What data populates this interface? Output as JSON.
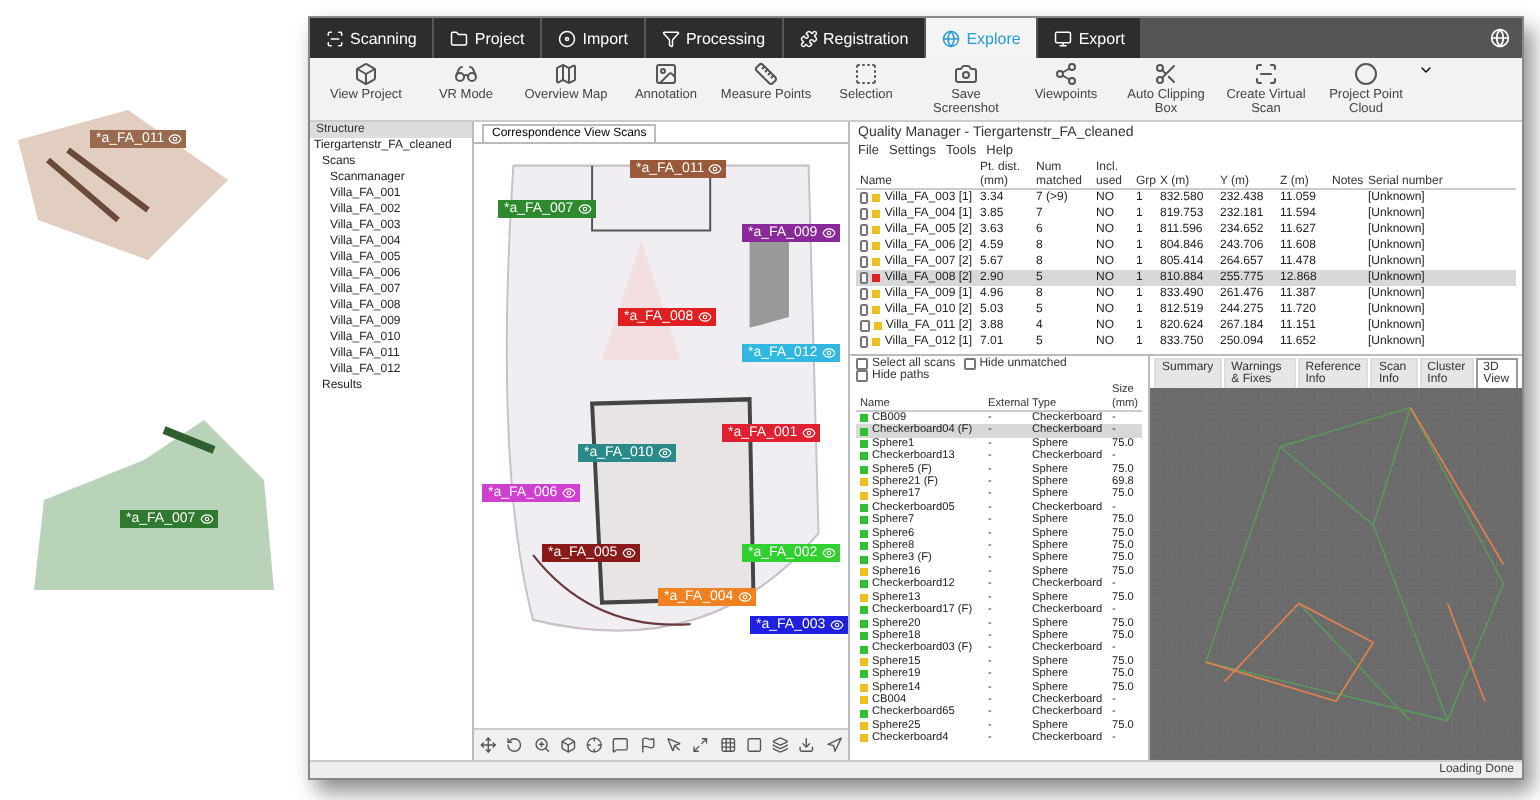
{
  "background_tags": [
    {
      "label": "*a_FA_011",
      "color": "#9a6a4e"
    },
    {
      "label": "*a_FA_007",
      "color": "#2f7a2f"
    }
  ],
  "workflow_tabs": [
    {
      "label": "Scanning",
      "selected": false
    },
    {
      "label": "Project",
      "selected": false
    },
    {
      "label": "Import",
      "selected": false
    },
    {
      "label": "Processing",
      "selected": false
    },
    {
      "label": "Registration",
      "selected": false
    },
    {
      "label": "Explore",
      "selected": true
    },
    {
      "label": "Export",
      "selected": false
    }
  ],
  "toolbar": [
    {
      "label": "View Project"
    },
    {
      "label": "VR Mode"
    },
    {
      "label": "Overview Map"
    },
    {
      "label": "Annotation"
    },
    {
      "label": "Measure Points"
    },
    {
      "label": "Selection"
    },
    {
      "label": "Save Screenshot"
    },
    {
      "label": "Viewpoints"
    },
    {
      "label": "Auto Clipping Box"
    },
    {
      "label": "Create Virtual Scan"
    },
    {
      "label": "Project Point Cloud"
    }
  ],
  "structure": {
    "title": "Structure",
    "tree": [
      {
        "label": "Tiergartenstr_FA_cleaned",
        "children": [
          {
            "label": "Scans",
            "children": [
              {
                "label": "Scanmanager"
              },
              {
                "label": "Villa_FA_001"
              },
              {
                "label": "Villa_FA_002"
              },
              {
                "label": "Villa_FA_003"
              },
              {
                "label": "Villa_FA_004"
              },
              {
                "label": "Villa_FA_005"
              },
              {
                "label": "Villa_FA_006"
              },
              {
                "label": "Villa_FA_007"
              },
              {
                "label": "Villa_FA_008"
              },
              {
                "label": "Villa_FA_009"
              },
              {
                "label": "Villa_FA_010"
              },
              {
                "label": "Villa_FA_011"
              },
              {
                "label": "Villa_FA_012"
              }
            ]
          },
          {
            "label": "Results"
          }
        ]
      }
    ]
  },
  "map": {
    "tab": "Correspondence View Scans",
    "tags": [
      {
        "label": "*a_FA_011",
        "color": "#9a5a3a"
      },
      {
        "label": "*a_FA_007",
        "color": "#2f8a2f"
      },
      {
        "label": "*a_FA_009",
        "color": "#8a2a9a"
      },
      {
        "label": "*a_FA_008",
        "color": "#e02020"
      },
      {
        "label": "*a_FA_012",
        "color": "#30b8e0"
      },
      {
        "label": "*a_FA_001",
        "color": "#e02030"
      },
      {
        "label": "*a_FA_006",
        "color": "#d040d0"
      },
      {
        "label": "*a_FA_010",
        "color": "#2a8a8a"
      },
      {
        "label": "*a_FA_005",
        "color": "#8a1a1a"
      },
      {
        "label": "*a_FA_004",
        "color": "#f08020"
      },
      {
        "label": "*a_FA_002",
        "color": "#30d030"
      },
      {
        "label": "*a_FA_003",
        "color": "#2020e0"
      }
    ]
  },
  "quality_manager": {
    "title": "Quality Manager - Tiergartenstr_FA_cleaned",
    "menu": [
      "File",
      "Settings",
      "Tools",
      "Help"
    ],
    "columns": [
      "Name",
      "Pt. dist. (mm)",
      "Num matched",
      "Incl. used",
      "Grp",
      "X (m)",
      "Y (m)",
      "Z (m)",
      "Notes",
      "Serial number"
    ],
    "rows": [
      {
        "selected": false,
        "color": "#f0c020",
        "cells": [
          "Villa_FA_003 [1]",
          "3.34",
          "7 (>9)",
          "NO",
          "1",
          "832.580",
          "232.438",
          "11.059",
          "",
          "[Unknown]"
        ]
      },
      {
        "selected": false,
        "color": "#f0c020",
        "cells": [
          "Villa_FA_004 [1]",
          "3.85",
          "7",
          "NO",
          "1",
          "819.753",
          "232.181",
          "11.594",
          "",
          "[Unknown]"
        ]
      },
      {
        "selected": false,
        "color": "#f0c020",
        "cells": [
          "Villa_FA_005 [2]",
          "3.63",
          "6",
          "NO",
          "1",
          "811.596",
          "234.652",
          "11.627",
          "",
          "[Unknown]"
        ]
      },
      {
        "selected": false,
        "color": "#f0c020",
        "cells": [
          "Villa_FA_006 [2]",
          "4.59",
          "8",
          "NO",
          "1",
          "804.846",
          "243.706",
          "11.608",
          "",
          "[Unknown]"
        ]
      },
      {
        "selected": false,
        "color": "#f0c020",
        "cells": [
          "Villa_FA_007 [2]",
          "5.67",
          "8",
          "NO",
          "1",
          "805.414",
          "264.657",
          "11.478",
          "",
          "[Unknown]"
        ]
      },
      {
        "selected": true,
        "color": "#e02020",
        "cells": [
          "Villa_FA_008 [2]",
          "2.90",
          "5",
          "NO",
          "1",
          "810.884",
          "255.775",
          "12.868",
          "",
          "[Unknown]"
        ]
      },
      {
        "selected": false,
        "color": "#f0c020",
        "cells": [
          "Villa_FA_009 [1]",
          "4.96",
          "8",
          "NO",
          "1",
          "833.490",
          "261.476",
          "11.387",
          "",
          "[Unknown]"
        ]
      },
      {
        "selected": false,
        "color": "#f0c020",
        "cells": [
          "Villa_FA_010 [2]",
          "5.03",
          "5",
          "NO",
          "1",
          "812.519",
          "244.275",
          "11.720",
          "",
          "[Unknown]"
        ]
      },
      {
        "selected": false,
        "color": "#f0c020",
        "cells": [
          "Villa_FA_011 [2]",
          "3.88",
          "4",
          "NO",
          "1",
          "820.624",
          "267.184",
          "11.151",
          "",
          "[Unknown]"
        ]
      },
      {
        "selected": false,
        "color": "#f0c020",
        "cells": [
          "Villa_FA_012 [1]",
          "7.01",
          "5",
          "NO",
          "1",
          "833.750",
          "250.094",
          "11.652",
          "",
          "[Unknown]"
        ]
      }
    ],
    "checks": [
      {
        "label": "Select all scans",
        "checked": false
      },
      {
        "label": "Hide unmatched",
        "checked": false
      },
      {
        "label": "Hide paths",
        "checked": false
      }
    ],
    "target_columns": [
      "Name",
      "External",
      "Type",
      "Size (mm)"
    ],
    "targets": [
      {
        "color": "#30c030",
        "selected": false,
        "cells": [
          "CB009",
          "-",
          "Checkerboard",
          "-"
        ]
      },
      {
        "color": "#30c030",
        "selected": true,
        "cells": [
          "Checkerboard04 (F)",
          "-",
          "Checkerboard",
          "-"
        ]
      },
      {
        "color": "#30c030",
        "selected": false,
        "cells": [
          "Sphere1",
          "-",
          "Sphere",
          "75.0"
        ]
      },
      {
        "color": "#30c030",
        "selected": false,
        "cells": [
          "Checkerboard13",
          "-",
          "Checkerboard",
          "-"
        ]
      },
      {
        "color": "#30c030",
        "selected": false,
        "cells": [
          "Sphere5 (F)",
          "-",
          "Sphere",
          "75.0"
        ]
      },
      {
        "color": "#f0c020",
        "selected": false,
        "cells": [
          "Sphere21 (F)",
          "-",
          "Sphere",
          "69.8"
        ]
      },
      {
        "color": "#f0c020",
        "selected": false,
        "cells": [
          "Sphere17",
          "-",
          "Sphere",
          "75.0"
        ]
      },
      {
        "color": "#30c030",
        "selected": false,
        "cells": [
          "Checkerboard05",
          "-",
          "Checkerboard",
          "-"
        ]
      },
      {
        "color": "#30c030",
        "selected": false,
        "cells": [
          "Sphere7",
          "-",
          "Sphere",
          "75.0"
        ]
      },
      {
        "color": "#30c030",
        "selected": false,
        "cells": [
          "Sphere6",
          "-",
          "Sphere",
          "75.0"
        ]
      },
      {
        "color": "#30c030",
        "selected": false,
        "cells": [
          "Sphere8",
          "-",
          "Sphere",
          "75.0"
        ]
      },
      {
        "color": "#30c030",
        "selected": false,
        "cells": [
          "Sphere3 (F)",
          "-",
          "Sphere",
          "75.0"
        ]
      },
      {
        "color": "#f0c020",
        "selected": false,
        "cells": [
          "Sphere16",
          "-",
          "Sphere",
          "75.0"
        ]
      },
      {
        "color": "#30c030",
        "selected": false,
        "cells": [
          "Checkerboard12",
          "-",
          "Checkerboard",
          "-"
        ]
      },
      {
        "color": "#f0c020",
        "selected": false,
        "cells": [
          "Sphere13",
          "-",
          "Sphere",
          "75.0"
        ]
      },
      {
        "color": "#30c030",
        "selected": false,
        "cells": [
          "Checkerboard17 (F)",
          "-",
          "Checkerboard",
          "-"
        ]
      },
      {
        "color": "#30c030",
        "selected": false,
        "cells": [
          "Sphere20",
          "-",
          "Sphere",
          "75.0"
        ]
      },
      {
        "color": "#30c030",
        "selected": false,
        "cells": [
          "Sphere18",
          "-",
          "Sphere",
          "75.0"
        ]
      },
      {
        "color": "#30c030",
        "selected": false,
        "cells": [
          "Checkerboard03 (F)",
          "-",
          "Checkerboard",
          "-"
        ]
      },
      {
        "color": "#f0c020",
        "selected": false,
        "cells": [
          "Sphere15",
          "-",
          "Sphere",
          "75.0"
        ]
      },
      {
        "color": "#30c030",
        "selected": false,
        "cells": [
          "Sphere19",
          "-",
          "Sphere",
          "75.0"
        ]
      },
      {
        "color": "#f0c020",
        "selected": false,
        "cells": [
          "Sphere14",
          "-",
          "Sphere",
          "75.0"
        ]
      },
      {
        "color": "#f0c020",
        "selected": false,
        "cells": [
          "CB004",
          "-",
          "Checkerboard",
          "-"
        ]
      },
      {
        "color": "#30c030",
        "selected": false,
        "cells": [
          "Checkerboard65",
          "-",
          "Checkerboard",
          "-"
        ]
      },
      {
        "color": "#f0c020",
        "selected": false,
        "cells": [
          "Sphere25",
          "-",
          "Sphere",
          "75.0"
        ]
      },
      {
        "color": "#f0c020",
        "selected": false,
        "cells": [
          "Checkerboard4",
          "-",
          "Checkerboard",
          "-"
        ]
      }
    ],
    "tabs": [
      {
        "label": "Summary",
        "selected": false
      },
      {
        "label": "Warnings & Fixes",
        "selected": false
      },
      {
        "label": "Reference Info",
        "selected": false
      },
      {
        "label": "Scan Info",
        "selected": false
      },
      {
        "label": "Cluster Info",
        "selected": false
      },
      {
        "label": "3D View",
        "selected": true
      }
    ]
  },
  "status": "Loading Done"
}
